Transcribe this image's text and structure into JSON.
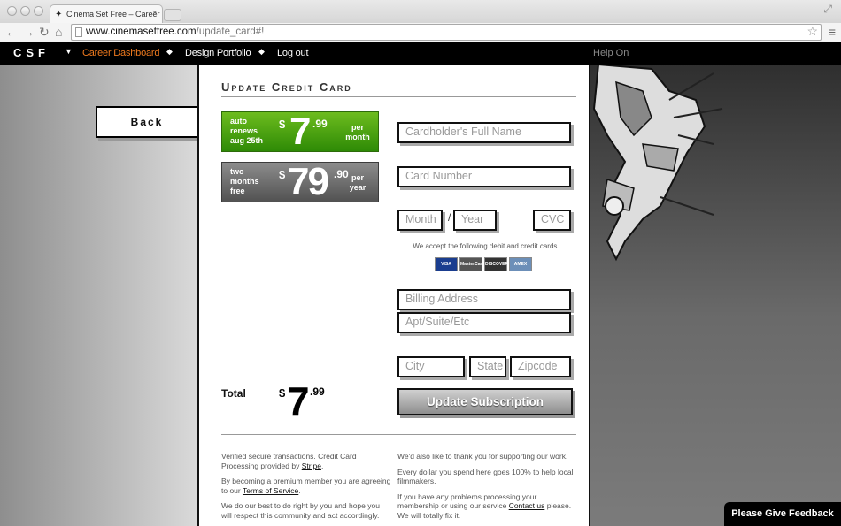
{
  "browser": {
    "tab_title": "Cinema Set Free – Career D",
    "url_host": "www.cinemasetfree.com",
    "url_path": "/update_card#!"
  },
  "nav": {
    "logo": "CSF",
    "items": [
      "Career Dashboard",
      "Design Portfolio",
      "Log out"
    ],
    "help": "Help On",
    "active_color": "#f07a1e"
  },
  "back_label": "Back",
  "page_title": "Update Credit Card",
  "plans": [
    {
      "note": "auto renews aug 25th",
      "currency": "$",
      "dollars": "7",
      "cents": ".99",
      "period": "per month",
      "color": "#3c9a0e"
    },
    {
      "note": "two months free",
      "currency": "$",
      "dollars": "79",
      "cents": ".90",
      "period": "per year",
      "color": "#6a6a6a"
    }
  ],
  "form": {
    "cardholder": "Cardholder's Full Name",
    "card_number": "Card Number",
    "month": "Month",
    "slash": "/",
    "year": "Year",
    "cvc": "CVC",
    "accept_text": "We accept the following debit and credit cards.",
    "billing_address": "Billing Address",
    "apt": "Apt/Suite/Etc",
    "city": "City",
    "state": "State",
    "zip": "Zipcode",
    "submit": "Update Subscription"
  },
  "cards": [
    "VISA",
    "MasterCard",
    "DISCOVER",
    "AMEX"
  ],
  "total": {
    "label": "Total",
    "currency": "$",
    "dollars": "7",
    "cents": ".99"
  },
  "footer": {
    "left": {
      "p1_text": "Verified secure transactions. Credit Card Processing provided by",
      "p1_link": "Stripe",
      "p1_end": ".",
      "p2_text": "By becoming a premium member you are agreeing to our",
      "p2_link": "Terms of Service",
      "p2_end": ".",
      "p3": "We do our best to do right by you and hope you will respect this community and act accordingly."
    },
    "right": {
      "p1": "We'd also like to thank you for supporting our work.",
      "p2": "Every dollar you spend here goes 100% to help local filmmakers.",
      "p3_text": "If you have any problems processing your membership or using our service",
      "p3_link": "Contact us",
      "p3_end": "please. We will totally fix it."
    }
  },
  "feedback": "Please Give Feedback"
}
